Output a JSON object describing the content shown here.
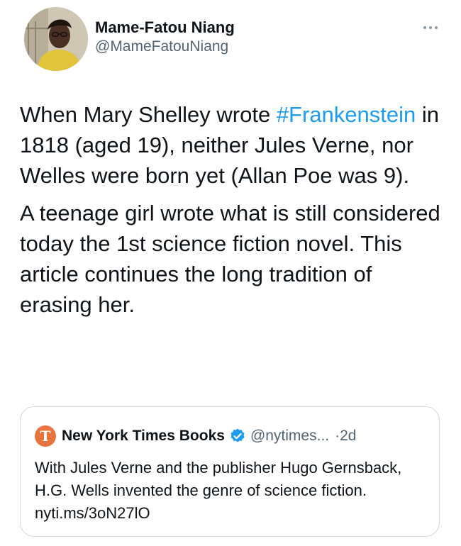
{
  "author": {
    "display_name": "Mame-Fatou Niang",
    "handle": "@MameFatouNiang"
  },
  "tweet": {
    "paragraph1": {
      "before": "When Mary Shelley wrote ",
      "hashtag": "#Frankenstein",
      "after": " in 1818 (aged 19), neither Jules Verne, nor Welles were born yet (Allan Poe was 9)."
    },
    "paragraph2": "A teenage girl wrote what is still considered today the 1st science fiction novel. This article continues the long tradition of erasing her."
  },
  "quoted_tweet": {
    "logo_glyph": "T",
    "name": "New York Times Books",
    "handle": "@nytimes...",
    "dot": "·",
    "time": "2d",
    "text": "With Jules Verne and the publisher Hugo Gernsback, H.G. Wells invented the genre of science fiction. nyti.ms/3oN27lO"
  },
  "icons": {
    "more": "more-horizontal-icon",
    "verified": "verified-badge-icon",
    "logo": "nyt-logo-icon"
  },
  "colors": {
    "hashtag": "#1d9bf0",
    "secondary_text": "#536471",
    "nyt_logo_bg": "#e8743b",
    "verified": "#1d9bf0",
    "border": "#cfd9de"
  }
}
